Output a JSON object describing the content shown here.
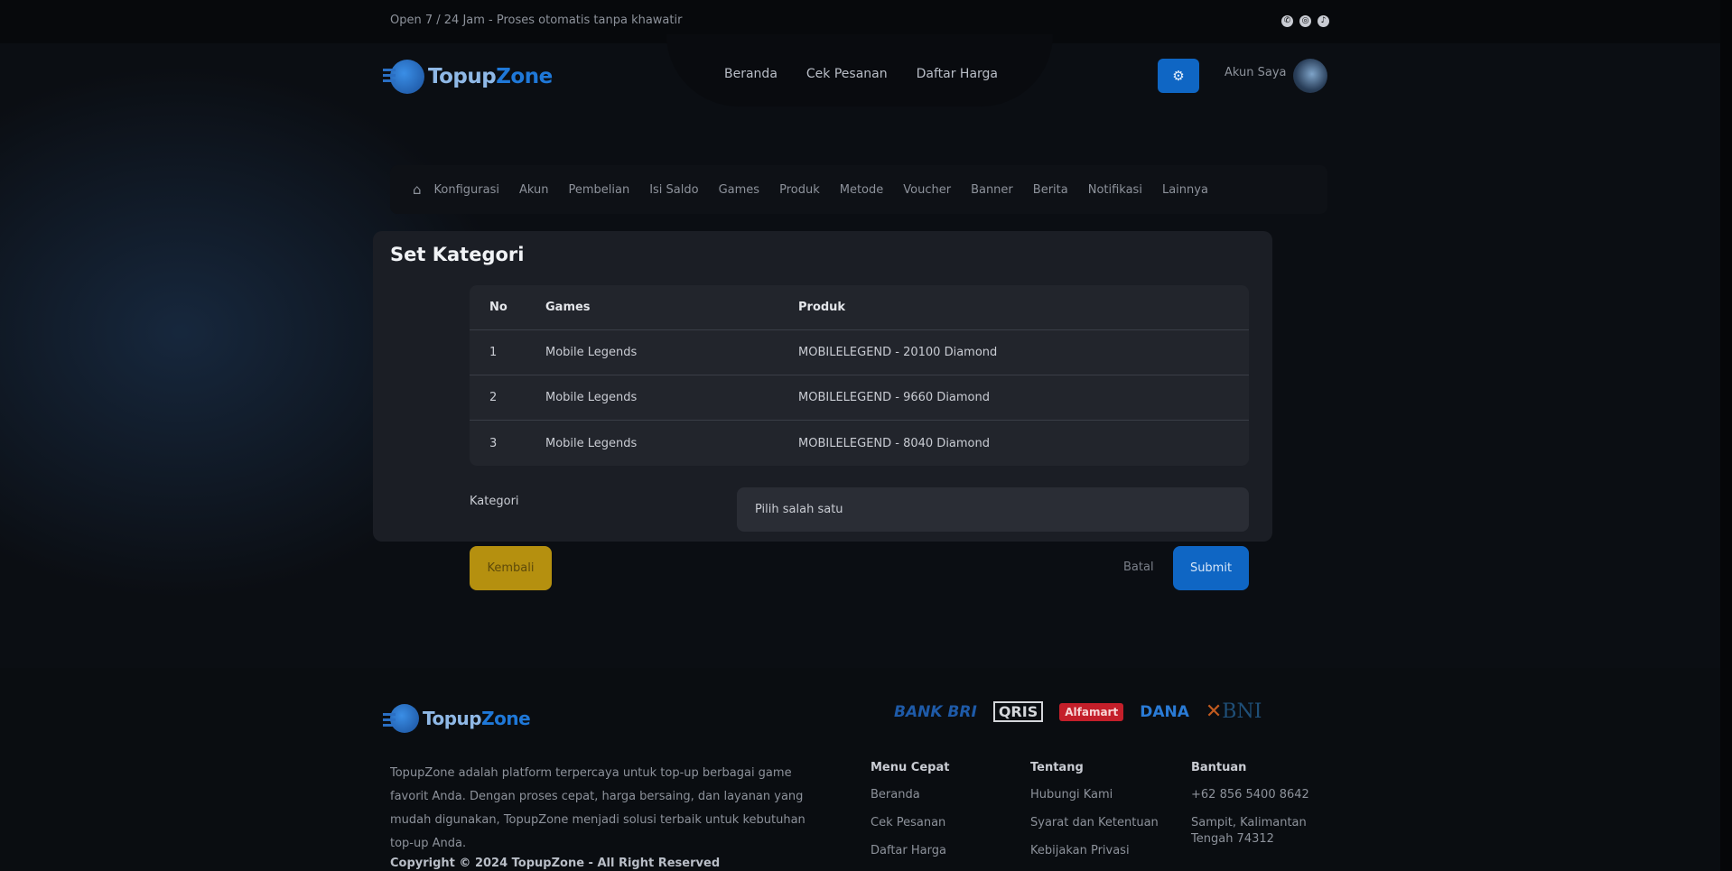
{
  "topbar": {
    "message": "Open 7 / 24 Jam - Proses otomatis tanpa khawatir",
    "social": [
      "whatsapp-icon",
      "instagram-icon",
      "tiktok-icon"
    ]
  },
  "header": {
    "logo": {
      "part1": "Topup",
      "part2": "Zone"
    },
    "nav": [
      "Beranda",
      "Cek Pesanan",
      "Daftar Harga"
    ],
    "settings_icon": "gear-icon",
    "account_label": "Akun Saya"
  },
  "subnav": {
    "home_icon": "home-icon",
    "items": [
      "Konfigurasi",
      "Akun",
      "Pembelian",
      "Isi Saldo",
      "Games",
      "Produk",
      "Metode",
      "Voucher",
      "Banner",
      "Berita",
      "Notifikasi",
      "Lainnya"
    ]
  },
  "modal": {
    "title": "Set Kategori",
    "table": {
      "headers": [
        "No",
        "Games",
        "Produk"
      ],
      "rows": [
        [
          "1",
          "Mobile Legends",
          "MOBILELEGEND - 20100 Diamond"
        ],
        [
          "2",
          "Mobile Legends",
          "MOBILELEGEND - 9660 Diamond"
        ],
        [
          "3",
          "Mobile Legends",
          "MOBILELEGEND - 8040 Diamond"
        ]
      ]
    },
    "kategori_label": "Kategori",
    "kategori_placeholder": "Pilih salah satu"
  },
  "actions": {
    "back": "Kembali",
    "cancel": "Batal",
    "submit": "Submit"
  },
  "footer": {
    "logo": {
      "part1": "Topup",
      "part2": "Zone"
    },
    "payments": [
      "BANK BRI",
      "QRIS",
      "Alfamart",
      "DANA",
      "BNI"
    ],
    "description": "TopupZone adalah platform terpercaya untuk top-up berbagai game favorit Anda. Dengan proses cepat, harga bersaing, dan layanan yang mudah digunakan, TopupZone menjadi solusi terbaik untuk kebutuhan top-up Anda.",
    "copyright": "Copyright © 2024 TopupZone - All Right Reserved",
    "menu_cepat": {
      "title": "Menu Cepat",
      "items": [
        "Beranda",
        "Cek Pesanan",
        "Daftar Harga"
      ]
    },
    "tentang": {
      "title": "Tentang",
      "items": [
        "Hubungi Kami",
        "Syarat dan Ketentuan",
        "Kebijakan Privasi"
      ]
    },
    "bantuan": {
      "title": "Bantuan",
      "items": [
        "+62 856 5400 8642",
        "Sampit, Kalimantan Tengah 74312"
      ]
    }
  },
  "colors": {
    "accent_blue": "#0f66c4",
    "back_yellow": "#b5900f",
    "modal_bg": "#1b1e25"
  }
}
